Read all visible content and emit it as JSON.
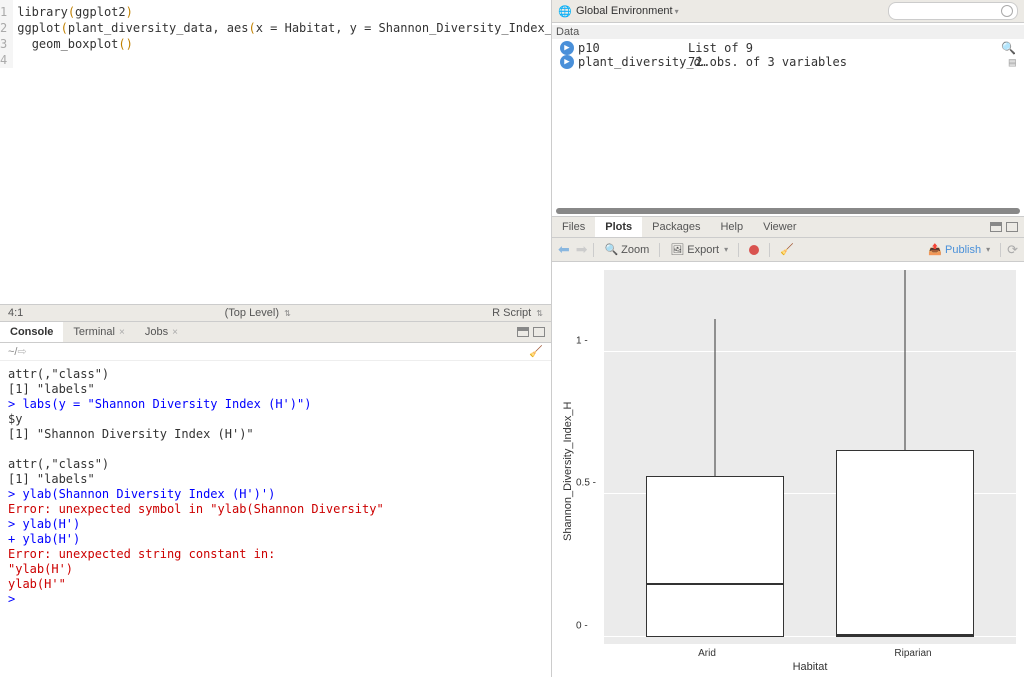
{
  "editor": {
    "lines": [
      "1",
      "2",
      "3",
      "4"
    ],
    "code": {
      "l1_fn": "library",
      "l1_arg": "ggplot2",
      "l2_fn": "ggplot",
      "l2_arg1": "plant_diversity_data",
      "l2_aes": "aes",
      "l2_x": "x = Habitat",
      "l2_y": "y = Shannon_Diversity_Index_H",
      "l2_plus": " +",
      "l3_fn": "geom_boxplot"
    }
  },
  "statusbar": {
    "pos": "4:1",
    "scope": "(Top Level) ",
    "lang": "R Script "
  },
  "console_tabs": {
    "console": "Console",
    "terminal": "Terminal",
    "jobs": "Jobs"
  },
  "console_path": "~/ ",
  "console": {
    "l1": "attr(,\"class\")",
    "l2": "[1] \"labels\"",
    "l3p": "> ",
    "l3": "labs(y = \"Shannon Diversity Index (H')\")",
    "l4": "$y",
    "l5": "[1] \"Shannon Diversity Index (H')\"",
    "l6": "",
    "l7": "attr(,\"class\")",
    "l8": "[1] \"labels\"",
    "l9p": "> ",
    "l9": "ylab(Shannon Diversity Index (H')')",
    "l10": "Error: unexpected symbol in \"ylab(Shannon Diversity\"",
    "l11p": "> ",
    "l11": "ylab(H')",
    "l12p": "+ ",
    "l12": "ylab(H')",
    "l13": "Error: unexpected string constant in:",
    "l14": "\"ylab(H')",
    "l15": "ylab(H'\"",
    "l16p": "> ",
    "l16": ""
  },
  "env": {
    "header": "Global Environment",
    "section": "Data",
    "rows": [
      {
        "name": "p10",
        "val": "List of 9"
      },
      {
        "name": "plant_diversity_d…",
        "val": "72 obs. of 3 variables"
      }
    ]
  },
  "plot_tabs": {
    "files": "Files",
    "plots": "Plots",
    "packages": "Packages",
    "help": "Help",
    "viewer": "Viewer"
  },
  "plot_toolbar": {
    "zoom": "Zoom",
    "export": "Export",
    "publish": "Publish"
  },
  "chart_data": {
    "type": "boxplot",
    "xlabel": "Habitat",
    "ylabel": "Shannon_Diversity_Index_H",
    "ylim": [
      0.0,
      1.3
    ],
    "yticks": [
      0.0,
      0.5,
      1.0
    ],
    "categories": [
      "Arid",
      "Riparian"
    ],
    "series": [
      {
        "name": "Arid",
        "min": 0.0,
        "q1": 0.0,
        "median": 0.18,
        "q3": 0.55,
        "max": 1.12
      },
      {
        "name": "Riparian",
        "min": 0.0,
        "q1": 0.0,
        "median": 0.0,
        "q3": 0.64,
        "max": 1.29
      }
    ]
  }
}
